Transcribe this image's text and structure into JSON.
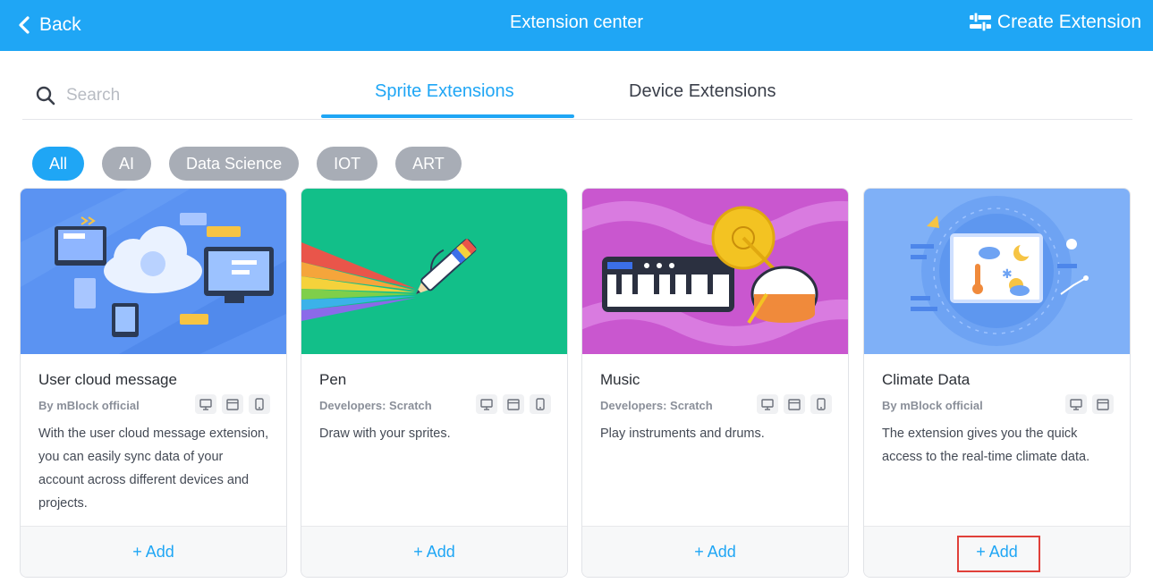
{
  "header": {
    "back_label": "Back",
    "title": "Extension center",
    "create_label": "Create Extension"
  },
  "search": {
    "placeholder": "Search"
  },
  "tabs": [
    {
      "label": "Sprite Extensions",
      "active": true
    },
    {
      "label": "Device Extensions",
      "active": false
    }
  ],
  "filters": [
    {
      "label": "All",
      "active": true
    },
    {
      "label": "AI"
    },
    {
      "label": "Data Science"
    },
    {
      "label": "IOT"
    },
    {
      "label": "ART"
    }
  ],
  "cards": [
    {
      "name": "User cloud message",
      "developer": "By mBlock official",
      "description": "With the user cloud message extension, you can easily sync data of your account across different devices and projects.",
      "platforms": [
        "desktop-icon",
        "browser-icon",
        "mobile-icon"
      ],
      "add_label": "Add"
    },
    {
      "name": "Pen",
      "developer": "Developers: Scratch",
      "description": "Draw with your sprites.",
      "platforms": [
        "desktop-icon",
        "browser-icon",
        "mobile-icon"
      ],
      "add_label": "Add"
    },
    {
      "name": "Music",
      "developer": "Developers: Scratch",
      "description": "Play instruments and drums.",
      "platforms": [
        "desktop-icon",
        "browser-icon",
        "mobile-icon"
      ],
      "add_label": "Add"
    },
    {
      "name": "Climate Data",
      "developer": "By mBlock official",
      "description": "The extension gives you the quick access to the real-time climate data.",
      "platforms": [
        "desktop-icon",
        "browser-icon"
      ],
      "add_label": "Add"
    }
  ],
  "colors": {
    "accent": "#1fa6f5",
    "chip_inactive": "#a8adb6",
    "highlight": "#e0403a"
  }
}
